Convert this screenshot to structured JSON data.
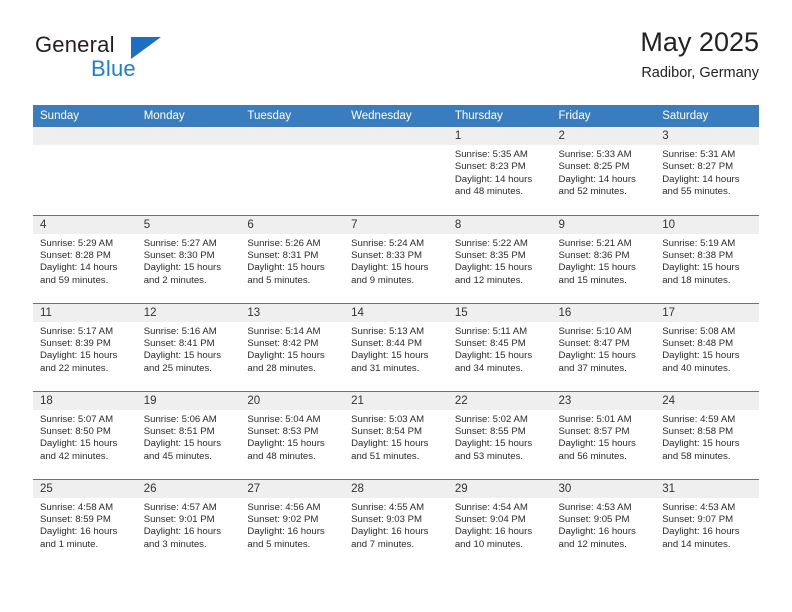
{
  "brand": {
    "name_top": "General",
    "name_bottom": "Blue",
    "triangle_color": "#1b6ec2",
    "blue_text_color": "#1b7fd4"
  },
  "header": {
    "title": "May 2025",
    "location": "Radibor, Germany",
    "header_bg": "#3a7dbf",
    "daynum_bg": "#efefef"
  },
  "weekdays": [
    "Sunday",
    "Monday",
    "Tuesday",
    "Wednesday",
    "Thursday",
    "Friday",
    "Saturday"
  ],
  "weeks": [
    [
      {
        "day": "",
        "empty": true
      },
      {
        "day": "",
        "empty": true
      },
      {
        "day": "",
        "empty": true
      },
      {
        "day": "",
        "empty": true
      },
      {
        "day": "1",
        "sunrise": "Sunrise: 5:35 AM",
        "sunset": "Sunset: 8:23 PM",
        "daylight": "Daylight: 14 hours and 48 minutes."
      },
      {
        "day": "2",
        "sunrise": "Sunrise: 5:33 AM",
        "sunset": "Sunset: 8:25 PM",
        "daylight": "Daylight: 14 hours and 52 minutes."
      },
      {
        "day": "3",
        "sunrise": "Sunrise: 5:31 AM",
        "sunset": "Sunset: 8:27 PM",
        "daylight": "Daylight: 14 hours and 55 minutes."
      }
    ],
    [
      {
        "day": "4",
        "sunrise": "Sunrise: 5:29 AM",
        "sunset": "Sunset: 8:28 PM",
        "daylight": "Daylight: 14 hours and 59 minutes."
      },
      {
        "day": "5",
        "sunrise": "Sunrise: 5:27 AM",
        "sunset": "Sunset: 8:30 PM",
        "daylight": "Daylight: 15 hours and 2 minutes."
      },
      {
        "day": "6",
        "sunrise": "Sunrise: 5:26 AM",
        "sunset": "Sunset: 8:31 PM",
        "daylight": "Daylight: 15 hours and 5 minutes."
      },
      {
        "day": "7",
        "sunrise": "Sunrise: 5:24 AM",
        "sunset": "Sunset: 8:33 PM",
        "daylight": "Daylight: 15 hours and 9 minutes."
      },
      {
        "day": "8",
        "sunrise": "Sunrise: 5:22 AM",
        "sunset": "Sunset: 8:35 PM",
        "daylight": "Daylight: 15 hours and 12 minutes."
      },
      {
        "day": "9",
        "sunrise": "Sunrise: 5:21 AM",
        "sunset": "Sunset: 8:36 PM",
        "daylight": "Daylight: 15 hours and 15 minutes."
      },
      {
        "day": "10",
        "sunrise": "Sunrise: 5:19 AM",
        "sunset": "Sunset: 8:38 PM",
        "daylight": "Daylight: 15 hours and 18 minutes."
      }
    ],
    [
      {
        "day": "11",
        "sunrise": "Sunrise: 5:17 AM",
        "sunset": "Sunset: 8:39 PM",
        "daylight": "Daylight: 15 hours and 22 minutes."
      },
      {
        "day": "12",
        "sunrise": "Sunrise: 5:16 AM",
        "sunset": "Sunset: 8:41 PM",
        "daylight": "Daylight: 15 hours and 25 minutes."
      },
      {
        "day": "13",
        "sunrise": "Sunrise: 5:14 AM",
        "sunset": "Sunset: 8:42 PM",
        "daylight": "Daylight: 15 hours and 28 minutes."
      },
      {
        "day": "14",
        "sunrise": "Sunrise: 5:13 AM",
        "sunset": "Sunset: 8:44 PM",
        "daylight": "Daylight: 15 hours and 31 minutes."
      },
      {
        "day": "15",
        "sunrise": "Sunrise: 5:11 AM",
        "sunset": "Sunset: 8:45 PM",
        "daylight": "Daylight: 15 hours and 34 minutes."
      },
      {
        "day": "16",
        "sunrise": "Sunrise: 5:10 AM",
        "sunset": "Sunset: 8:47 PM",
        "daylight": "Daylight: 15 hours and 37 minutes."
      },
      {
        "day": "17",
        "sunrise": "Sunrise: 5:08 AM",
        "sunset": "Sunset: 8:48 PM",
        "daylight": "Daylight: 15 hours and 40 minutes."
      }
    ],
    [
      {
        "day": "18",
        "sunrise": "Sunrise: 5:07 AM",
        "sunset": "Sunset: 8:50 PM",
        "daylight": "Daylight: 15 hours and 42 minutes."
      },
      {
        "day": "19",
        "sunrise": "Sunrise: 5:06 AM",
        "sunset": "Sunset: 8:51 PM",
        "daylight": "Daylight: 15 hours and 45 minutes."
      },
      {
        "day": "20",
        "sunrise": "Sunrise: 5:04 AM",
        "sunset": "Sunset: 8:53 PM",
        "daylight": "Daylight: 15 hours and 48 minutes."
      },
      {
        "day": "21",
        "sunrise": "Sunrise: 5:03 AM",
        "sunset": "Sunset: 8:54 PM",
        "daylight": "Daylight: 15 hours and 51 minutes."
      },
      {
        "day": "22",
        "sunrise": "Sunrise: 5:02 AM",
        "sunset": "Sunset: 8:55 PM",
        "daylight": "Daylight: 15 hours and 53 minutes."
      },
      {
        "day": "23",
        "sunrise": "Sunrise: 5:01 AM",
        "sunset": "Sunset: 8:57 PM",
        "daylight": "Daylight: 15 hours and 56 minutes."
      },
      {
        "day": "24",
        "sunrise": "Sunrise: 4:59 AM",
        "sunset": "Sunset: 8:58 PM",
        "daylight": "Daylight: 15 hours and 58 minutes."
      }
    ],
    [
      {
        "day": "25",
        "sunrise": "Sunrise: 4:58 AM",
        "sunset": "Sunset: 8:59 PM",
        "daylight": "Daylight: 16 hours and 1 minute."
      },
      {
        "day": "26",
        "sunrise": "Sunrise: 4:57 AM",
        "sunset": "Sunset: 9:01 PM",
        "daylight": "Daylight: 16 hours and 3 minutes."
      },
      {
        "day": "27",
        "sunrise": "Sunrise: 4:56 AM",
        "sunset": "Sunset: 9:02 PM",
        "daylight": "Daylight: 16 hours and 5 minutes."
      },
      {
        "day": "28",
        "sunrise": "Sunrise: 4:55 AM",
        "sunset": "Sunset: 9:03 PM",
        "daylight": "Daylight: 16 hours and 7 minutes."
      },
      {
        "day": "29",
        "sunrise": "Sunrise: 4:54 AM",
        "sunset": "Sunset: 9:04 PM",
        "daylight": "Daylight: 16 hours and 10 minutes."
      },
      {
        "day": "30",
        "sunrise": "Sunrise: 4:53 AM",
        "sunset": "Sunset: 9:05 PM",
        "daylight": "Daylight: 16 hours and 12 minutes."
      },
      {
        "day": "31",
        "sunrise": "Sunrise: 4:53 AM",
        "sunset": "Sunset: 9:07 PM",
        "daylight": "Daylight: 16 hours and 14 minutes."
      }
    ]
  ]
}
